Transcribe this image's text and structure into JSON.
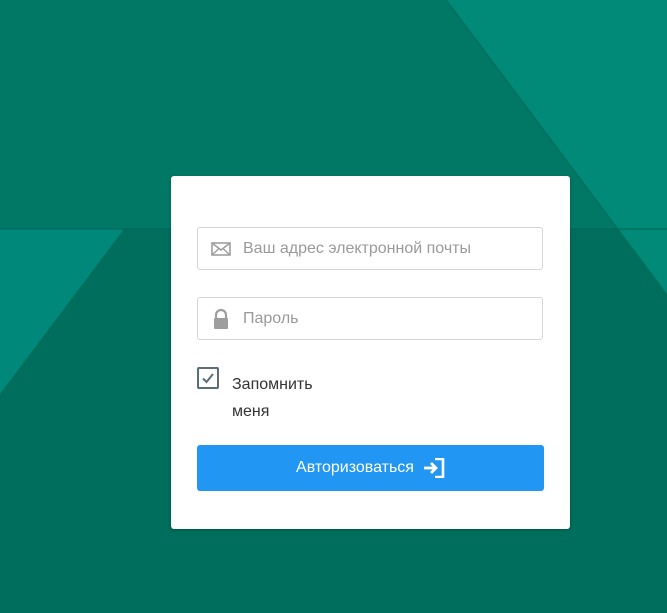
{
  "login_form": {
    "email_placeholder": "Ваш адрес электронной почты",
    "email_value": "",
    "password_placeholder": "Пароль",
    "password_value": "",
    "remember_label": "Запомнить меня",
    "remember_checked": true,
    "submit_label": "Авторизоваться"
  },
  "icons": {
    "email": "envelope-icon",
    "password": "lock-icon",
    "submit": "login-icon",
    "checkbox": "check-icon"
  },
  "colors": {
    "background_dark": "#006f5d",
    "background_light": "#00897b",
    "card": "#ffffff",
    "button": "#2196f3",
    "icon_gray": "#9e9e9e"
  }
}
